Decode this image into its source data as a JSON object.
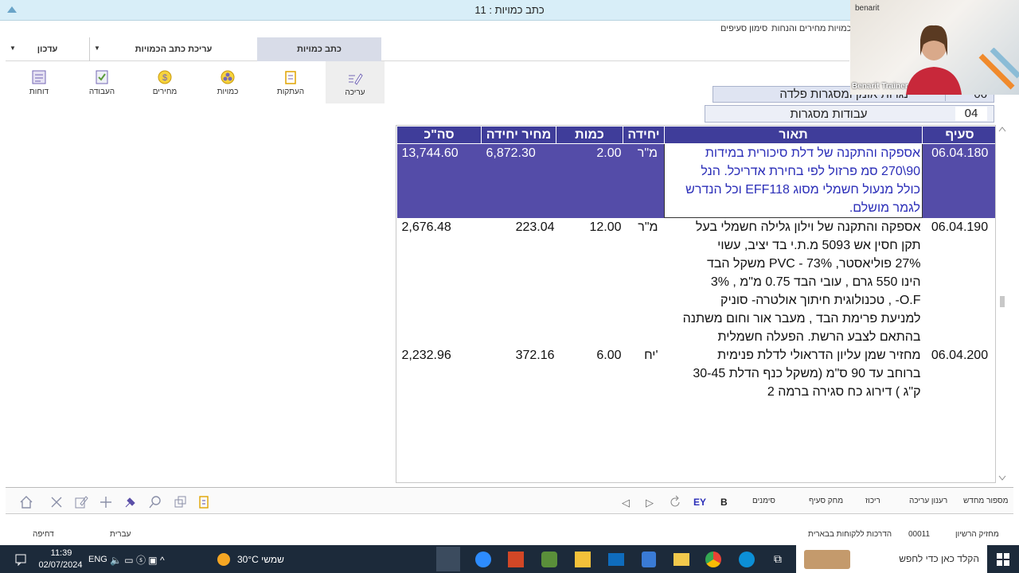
{
  "window": {
    "title": "כתב כמויות : 11"
  },
  "menu_line": [
    "כמויות",
    "מחירים והנחות",
    "סימון סעיפים"
  ],
  "tabs": [
    {
      "label": "עדכון"
    },
    {
      "label": "עריכת כתב הכמויות"
    },
    {
      "label": "כתב כמויות"
    }
  ],
  "ribbon": [
    {
      "label": "דוחות",
      "icon": "reports-icon"
    },
    {
      "label": "העבודה",
      "icon": "job-icon"
    },
    {
      "label": "מחירים",
      "icon": "prices-icon"
    },
    {
      "label": "כמויות",
      "icon": "quantities-icon"
    },
    {
      "label": "העתקות",
      "icon": "copy-icon"
    },
    {
      "label": "עריכה",
      "icon": "edit-icon"
    }
  ],
  "header": {
    "chapter_code": "06",
    "chapter_name": "נגרות אומן ומסגרות פלדה",
    "subchapter_code": "04",
    "subchapter_name": "עבודות מסגרות"
  },
  "columns": [
    "סה\"כ",
    "מחיר יחידה",
    "כמות",
    "יחידה",
    "תאור",
    "סעיף"
  ],
  "rows": [
    {
      "code": "06.04.180",
      "description": "אספקה והתקנה של דלת סיכורית במידות\n90\\270 סמ פרזול לפי בחירת אדריכל. הנל\nכולל מנעול חשמלי מסוג EFF118 וכל הנדרש\nלגמר מושלם.",
      "unit": "מ\"ר",
      "quantity": "2.00",
      "unit_price": "6,872.30",
      "total": "13,744.60",
      "selected": true
    },
    {
      "code": "06.04.190",
      "description": "אספקה והתקנה של וילון גלילה חשמלי בעל\nתקן חסין אש 5093 מ.ת.י  בד יציב, עשוי\n27% פוליאסטר, 73% - PVC   משקל הבד\nהינו 550 גרם , עובי הבד 0.75 מ\"מ , 3%\nO.F- , טכנולוגית חיתוך אולטרה- סוניק\nלמניעת פרימת הבד , מעבר אור וחום משתנה\nבהתאם לצבע הרשת. הפעלה חשמלית",
      "unit": "מ\"ר",
      "quantity": "12.00",
      "unit_price": "223.04",
      "total": "2,676.48",
      "selected": false
    },
    {
      "code": "06.04.200",
      "description": "מחזיר שמן עליון הדראולי לדלת פנימית\nברוחב עד 90 ס\"מ (משקל כנף הדלת 30-45\nק\"ג ) דירוג כח סגירה ברמה 2",
      "unit": "יח'",
      "quantity": "6.00",
      "unit_price": "372.16",
      "total": "2,232.96",
      "selected": false
    }
  ],
  "bottom_toolbar": {
    "labels": [
      "מספור מחדש",
      "רענון עריכה",
      "ריכוז",
      "מחק סעיף",
      "סימנים"
    ],
    "bold": "B",
    "ey": "EY"
  },
  "status": {
    "left1": "דחיפה",
    "left2": "עברית",
    "num": "00011",
    "text": "הדרכות ללקוחות בבארית",
    "right": "מחזיק הרשיון"
  },
  "taskbar": {
    "search": "הקלד כאן כדי לחפש",
    "weather": "30°C  שמשי",
    "lang": "ENG",
    "time": "11:39",
    "date": "02/07/2024"
  },
  "video": {
    "name": "Benarit Trainer",
    "brand": "benarit"
  },
  "colors": {
    "header_blue": "#3f3d9a",
    "selected_row": "#544ca8",
    "title_bar": "#d8eef8",
    "taskbar": "#1c2a3a"
  }
}
